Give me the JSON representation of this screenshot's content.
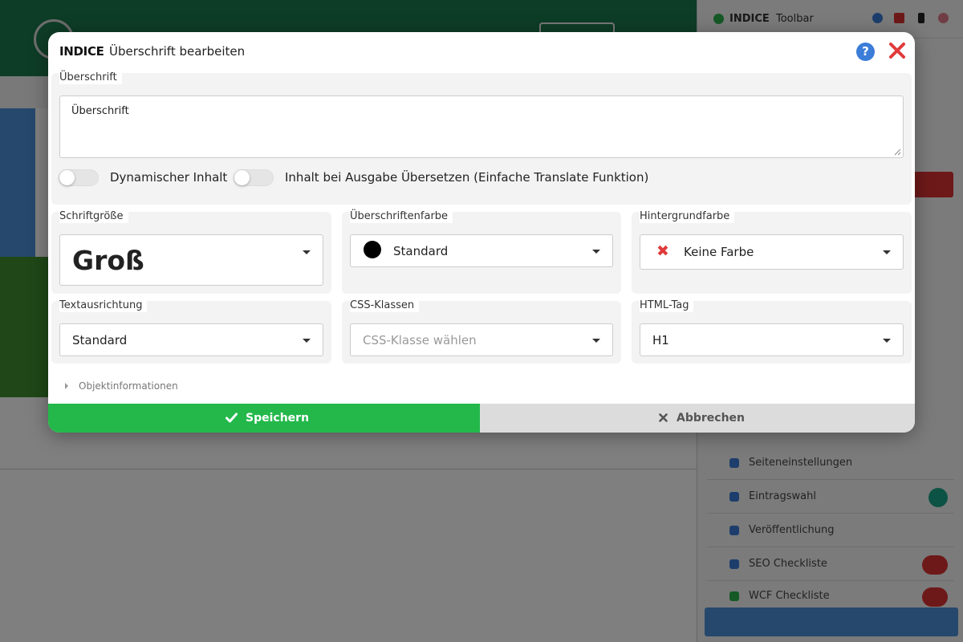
{
  "background": {
    "sidebar_title": "INDICE",
    "sidebar_subtitle": "Toolbar",
    "sidebar_rows": [
      "Seiteneinstellungen",
      "Eintragswahl",
      "Veröffentlichung",
      "SEO Checkliste",
      "WCF Checkliste"
    ]
  },
  "modal": {
    "app_name": "INDICE",
    "title": "Überschrift bearbeiten",
    "help_icon": "question-circle-icon",
    "close_icon": "close-x-icon"
  },
  "heading": {
    "label": "Überschrift",
    "value": "Überschrift"
  },
  "toggles": [
    {
      "label": "Dynamischer Inhalt",
      "checked": false
    },
    {
      "label": "Inhalt bei Ausgabe Übersetzen (Einfache Translate Funktion)",
      "checked": false
    }
  ],
  "font_size": {
    "label": "Schriftgröße",
    "value": "Groß"
  },
  "heading_color": {
    "label": "Überschriftenfarbe",
    "value": "Standard",
    "swatch": "#000000"
  },
  "background_color": {
    "label": "Hintergrundfarbe",
    "value": "Keine Farbe",
    "icon": "red-x-icon"
  },
  "text_align": {
    "label": "Textausrichtung",
    "value": "Standard"
  },
  "css_classes": {
    "label": "CSS-Klassen",
    "placeholder": "CSS-Klasse wählen"
  },
  "html_tag": {
    "label": "HTML-Tag",
    "value": "H1"
  },
  "object_info": {
    "label": "Objektinformationen"
  },
  "buttons": {
    "save": "Speichern",
    "cancel": "Abbrechen"
  },
  "colors": {
    "save_green": "#24b84b",
    "cancel_grey": "#dcdcdc",
    "help_blue": "#3b7dd8",
    "close_red": "#e03a3a"
  }
}
